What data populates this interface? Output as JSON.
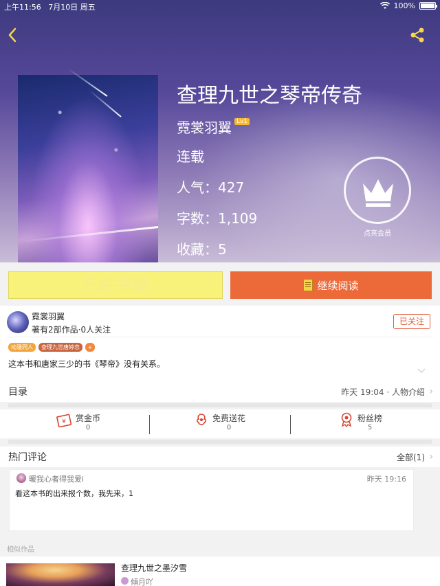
{
  "status_bar": {
    "time": "上午11:56",
    "date": "7月10日 周五",
    "battery": "100%"
  },
  "book": {
    "title": "查理九世之琴帝传奇",
    "author": "霓裳羽翼",
    "author_level": "Lv1",
    "status": "连载",
    "popularity": "人气：427",
    "word_count": "字数：1,109",
    "favorites": "收藏：5"
  },
  "vip": {
    "label": "点亮会员"
  },
  "actions": {
    "shelf_label": "已在书架",
    "read_label": "继续阅读"
  },
  "author_panel": {
    "name": "霓裳羽翼",
    "works": "著有2部作品·0人关注",
    "follow_label": "已关注",
    "tags": [
      {
        "label": "动漫同人",
        "color": "#f2a53a"
      },
      {
        "label": "查理九世唐婷恋",
        "color": "#c8643e"
      }
    ],
    "tag_more": "+",
    "description": "这本书和唐家三少的书《琴帝》没有关系。"
  },
  "toc": {
    "title": "目录",
    "updated": "昨天 19:04 · 人物介绍"
  },
  "stats": [
    {
      "label": "赏金币",
      "value": "0",
      "icon": "red-envelope-icon"
    },
    {
      "label": "免费送花",
      "value": "0",
      "icon": "flower-icon"
    },
    {
      "label": "粉丝榜",
      "value": "5",
      "icon": "medal-icon"
    }
  ],
  "comments": {
    "title": "热门评论",
    "all_label": "全部(1)",
    "items": [
      {
        "user": "暖我心者得我爱i",
        "time": "昨天 19:16",
        "text": "看这本书的出来报个数，我先来，1"
      }
    ]
  },
  "similar": {
    "label": "相似作品",
    "items": [
      {
        "title": "查理九世之墨汐雪",
        "author": "傾月吖"
      }
    ]
  },
  "colors": {
    "accent": "#ec6a3a",
    "shelf_button": "#f8f27a",
    "follow": "#e25a3a"
  }
}
